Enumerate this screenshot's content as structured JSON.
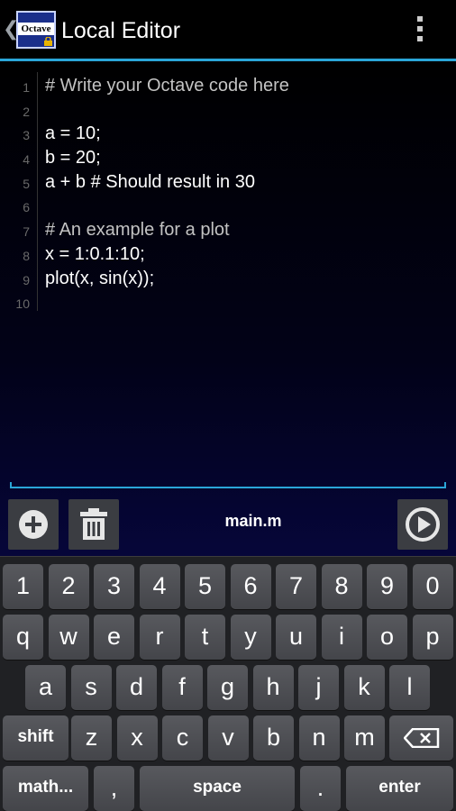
{
  "action_bar": {
    "back_glyph": "❮",
    "logo_text": "Octave",
    "title": "Local Editor",
    "overflow_icon": "overflow-menu-icon"
  },
  "editor": {
    "lines": [
      {
        "num": "1",
        "text": "# Write your Octave code here",
        "comment": true
      },
      {
        "num": "2",
        "text": "",
        "comment": false
      },
      {
        "num": "3",
        "text": "a = 10;",
        "comment": false
      },
      {
        "num": "4",
        "text": "b = 20;",
        "comment": false
      },
      {
        "num": "5",
        "text": "a + b # Should result in 30",
        "comment": false
      },
      {
        "num": "6",
        "text": "",
        "comment": false
      },
      {
        "num": "7",
        "text": "# An example for a plot",
        "comment": true
      },
      {
        "num": "8",
        "text": "x = 1:0.1:10;",
        "comment": false
      },
      {
        "num": "9",
        "text": "plot(x, sin(x));",
        "comment": false
      },
      {
        "num": "10",
        "text": "",
        "comment": false
      }
    ]
  },
  "toolbar": {
    "add_icon": "add-circle-icon",
    "delete_icon": "trash-icon",
    "filename": "main.m",
    "run_icon": "play-icon"
  },
  "keyboard": {
    "row1": [
      "1",
      "2",
      "3",
      "4",
      "5",
      "6",
      "7",
      "8",
      "9",
      "0"
    ],
    "row2": [
      "q",
      "w",
      "e",
      "r",
      "t",
      "y",
      "u",
      "i",
      "o",
      "p"
    ],
    "row3": [
      "a",
      "s",
      "d",
      "f",
      "g",
      "h",
      "j",
      "k",
      "l"
    ],
    "row4": [
      "shift",
      "z",
      "x",
      "c",
      "v",
      "b",
      "n",
      "m",
      "backspace"
    ],
    "row5": [
      "math...",
      ",",
      "space",
      ".",
      "enter"
    ]
  },
  "colors": {
    "accent": "#2aa6d8",
    "key_face": "#4e4f54",
    "keyboard_bg": "#202124"
  }
}
